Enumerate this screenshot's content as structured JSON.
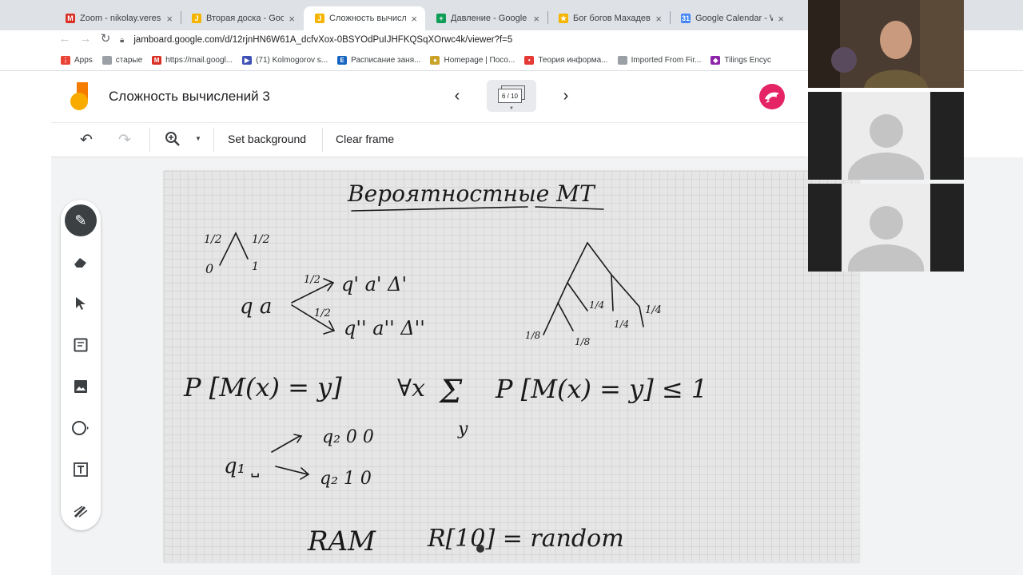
{
  "browser": {
    "tabs": [
      {
        "title": "Zoom - nikolay.veresh",
        "icon": "gmail-icon",
        "color": "#d93025"
      },
      {
        "title": "Вторая доска - Googl",
        "icon": "jamboard-icon",
        "color": "#f4b400"
      },
      {
        "title": "Сложность вычислен",
        "icon": "jamboard-icon",
        "color": "#f4b400"
      },
      {
        "title": "Давление - Google Sh",
        "icon": "sheets-icon",
        "color": "#0f9d58"
      },
      {
        "title": "Бог богов Махадев с",
        "icon": "star-icon",
        "color": "#f4b400"
      },
      {
        "title": "Google Calendar - We",
        "icon": "calendar-icon",
        "color": "#4285f4"
      }
    ],
    "url": "jamboard.google.com/d/12rjnHN6W61A_dcfvXox-0BSYOdPuIJHFKQSqXOrwc4k/viewer?f=5",
    "bookmarks": [
      {
        "label": "Apps",
        "color": "#ea4335"
      },
      {
        "label": "старые",
        "color": "#9aa0a6"
      },
      {
        "label": "https://mail.googl...",
        "color": "#d93025"
      },
      {
        "label": "(71) Kolmogorov s...",
        "color": "#3f51b5"
      },
      {
        "label": "Расписание заня...",
        "color": "#1565c0"
      },
      {
        "label": "Homepage | Посо...",
        "color": "#c9a227"
      },
      {
        "label": "Теория информа...",
        "color": "#e53935"
      },
      {
        "label": "Imported From Fir...",
        "color": "#9aa0a6"
      },
      {
        "label": "Tilings Encyc",
        "color": "#8e24aa"
      }
    ]
  },
  "jamboard": {
    "title": "Сложность вычислений 3",
    "frame_indicator": "6 / 10",
    "toolbar": {
      "set_background": "Set background",
      "clear_frame": "Clear frame"
    },
    "colors": {
      "avatar": "#e52466",
      "logo_yellow": "#f9ab00",
      "logo_orange": "#f57c00"
    }
  },
  "whiteboard": {
    "title": "Вероятностные МТ",
    "tree_left_labels": [
      "1/2",
      "1/2",
      "0",
      "1"
    ],
    "state": "q a",
    "branch_prob_upper": "1/2",
    "branch_prob_lower": "1/2",
    "branch_upper": "q' a' Δ'",
    "branch_lower": "q'' a'' Δ''",
    "tree_right_labels": [
      "1/4",
      "1/4",
      "1/4",
      "1/8",
      "1/8"
    ],
    "prob_expr": "P [M(x) = y]",
    "sum_expr_prefix": "∀x",
    "sum_symbol": "Σ",
    "sum_index": "y",
    "sum_expr_suffix": "P [M(x) = y] ≤ 1",
    "q1": "q₁ ˽",
    "q2_upper": "q₂ 0  0",
    "q2_lower": "q₂ 1   0",
    "ram_left": "RAM",
    "ram_right": "R[10] = random"
  }
}
